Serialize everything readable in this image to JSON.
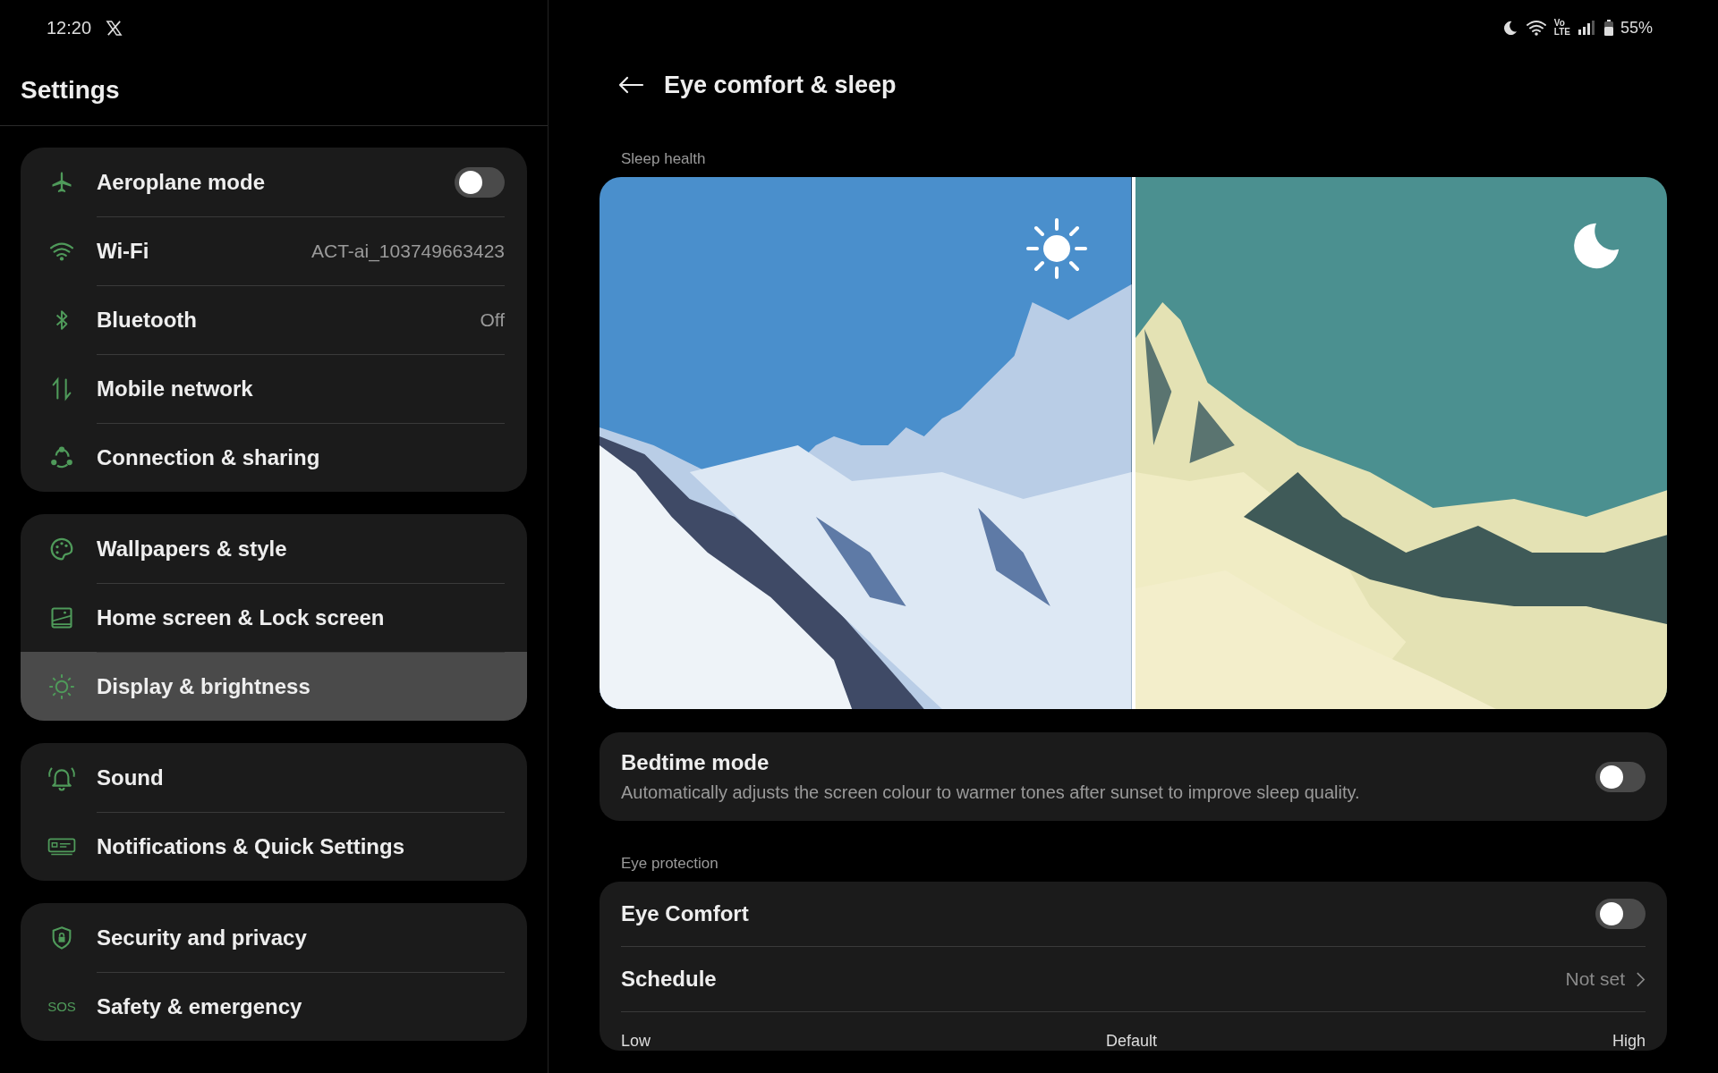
{
  "status_bar": {
    "time": "12:20",
    "network_badge_top": "Vo",
    "network_badge_bottom": "LTE",
    "battery": "55%"
  },
  "sidebar": {
    "title": "Settings",
    "groups": [
      {
        "items": [
          {
            "label": "Aeroplane mode",
            "kind": "toggle",
            "on": false,
            "selected": false
          },
          {
            "label": "Wi-Fi",
            "kind": "value",
            "value": "ACT-ai_103749663423",
            "selected": false
          },
          {
            "label": "Bluetooth",
            "kind": "value",
            "value": "Off",
            "selected": false
          },
          {
            "label": "Mobile network",
            "kind": "plain",
            "selected": false
          },
          {
            "label": "Connection & sharing",
            "kind": "plain",
            "selected": false
          }
        ]
      },
      {
        "items": [
          {
            "label": "Wallpapers & style",
            "kind": "plain",
            "selected": false
          },
          {
            "label": "Home screen & Lock screen",
            "kind": "plain",
            "selected": false
          },
          {
            "label": "Display & brightness",
            "kind": "plain",
            "selected": true
          }
        ]
      },
      {
        "items": [
          {
            "label": "Sound",
            "kind": "plain",
            "selected": false
          },
          {
            "label": "Notifications & Quick Settings",
            "kind": "plain",
            "selected": false
          }
        ]
      },
      {
        "items": [
          {
            "label": "Security and privacy",
            "kind": "plain",
            "selected": false
          },
          {
            "label": "Safety & emergency",
            "kind": "plain",
            "badge": "SOS",
            "selected": false
          }
        ]
      }
    ]
  },
  "page": {
    "title": "Eye comfort & sleep",
    "sleep_health": {
      "label": "Sleep health",
      "bedtime": {
        "title": "Bedtime mode",
        "description": "Automatically adjusts the screen colour to warmer tones after sunset to improve sleep quality.",
        "on": false
      }
    },
    "eye_protection": {
      "label": "Eye protection",
      "rows": [
        {
          "label": "Eye Comfort",
          "kind": "toggle",
          "on": false
        },
        {
          "label": "Schedule",
          "kind": "link",
          "value": "Not set"
        },
        {
          "kind": "scale",
          "labels": [
            "Low",
            "Default",
            "High"
          ]
        }
      ]
    }
  }
}
